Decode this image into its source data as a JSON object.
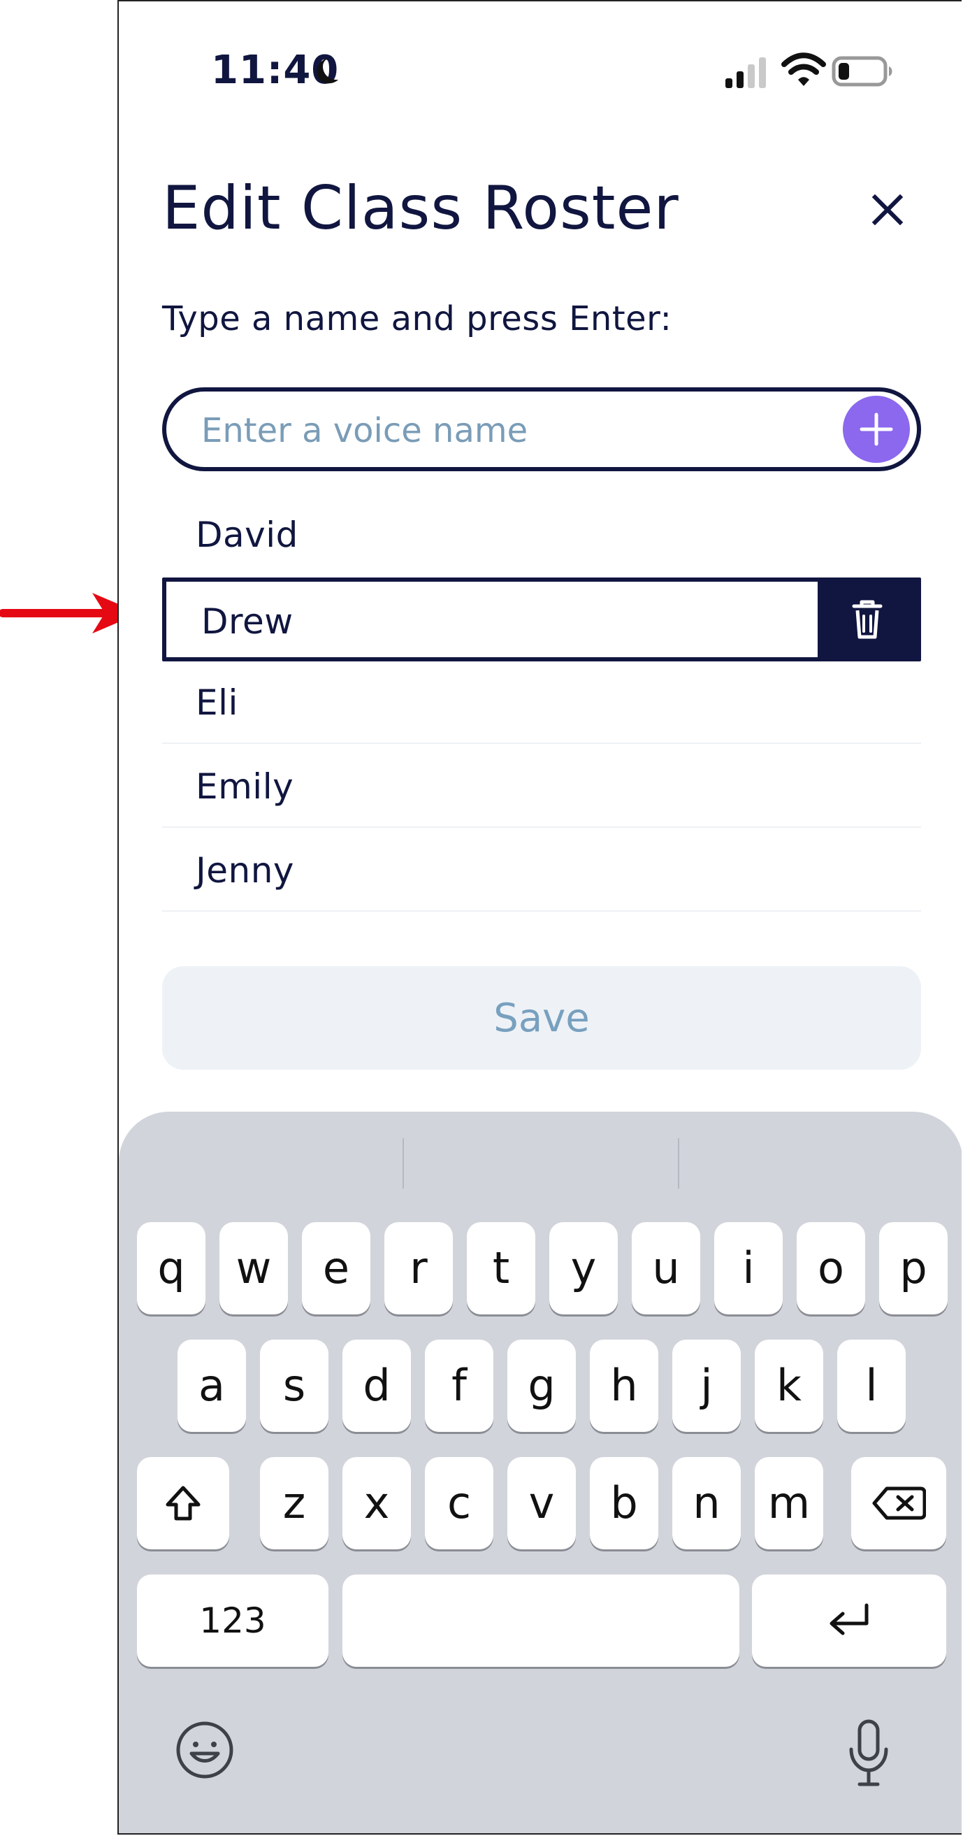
{
  "status_bar": {
    "time": "11:40",
    "icons": [
      "moon-icon",
      "signal-icon",
      "wifi-icon",
      "battery-icon"
    ]
  },
  "modal": {
    "title": "Edit Class Roster",
    "close_icon": "close-icon",
    "instruction": "Type a name and press Enter:",
    "input": {
      "value": "",
      "placeholder": "Enter a voice name"
    },
    "add_icon": "plus-icon"
  },
  "roster": {
    "items": [
      {
        "name": "David",
        "selected": false
      },
      {
        "name": "Drew",
        "selected": true,
        "action_icon": "trash-icon"
      },
      {
        "name": "Eli",
        "selected": false
      },
      {
        "name": "Emily",
        "selected": false
      },
      {
        "name": "Jenny",
        "selected": false
      }
    ]
  },
  "actions": {
    "save_label": "Save"
  },
  "keyboard": {
    "rows": [
      [
        "q",
        "w",
        "e",
        "r",
        "t",
        "y",
        "u",
        "i",
        "o",
        "p"
      ],
      [
        "a",
        "s",
        "d",
        "f",
        "g",
        "h",
        "j",
        "k",
        "l"
      ],
      [
        "shift",
        "z",
        "x",
        "c",
        "v",
        "b",
        "n",
        "m",
        "backspace"
      ],
      [
        "123",
        "space",
        "return"
      ]
    ],
    "number_key_label": "123",
    "bottom_icons": [
      "emoji-icon",
      "microphone-icon"
    ]
  },
  "annotation": {
    "icon": "red-arrow-icon",
    "color": "#e50914"
  },
  "colors": {
    "primary": "#10163f",
    "accent": "#8b68ee",
    "placeholder": "#7a9cb7",
    "save_background": "#eef2f6",
    "keyboard_background": "#d1d4db"
  }
}
